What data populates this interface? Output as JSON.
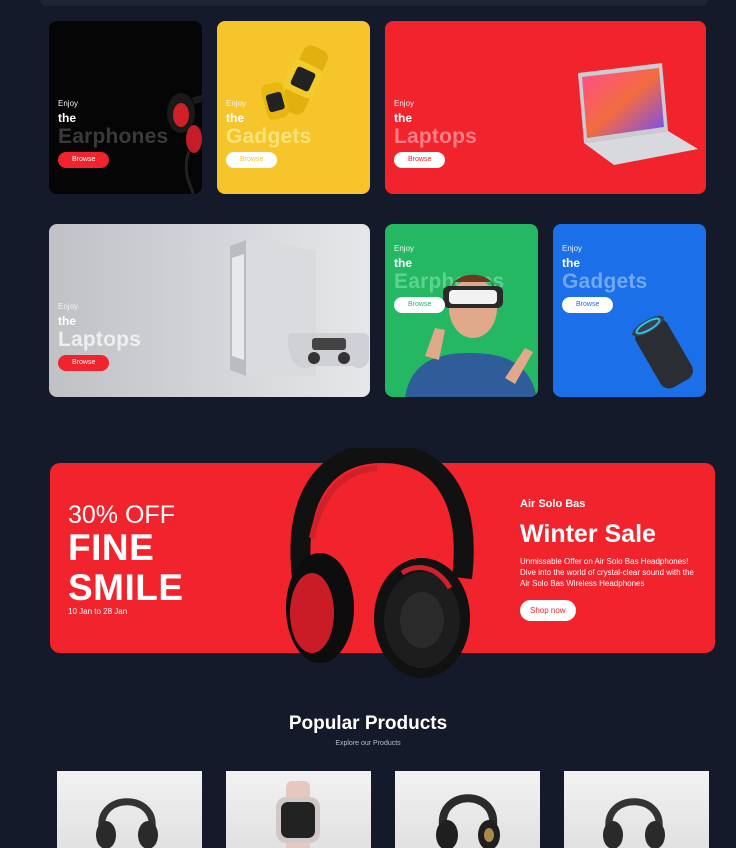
{
  "cards": [
    {
      "enjoy": "Enjoy",
      "the": "the",
      "title": "Earphones",
      "button": "Browse"
    },
    {
      "enjoy": "Enjoy",
      "the": "the",
      "title": "Gadgets",
      "button": "Browse"
    },
    {
      "enjoy": "Enjoy",
      "the": "the",
      "title": "Laptops",
      "button": "Browse"
    },
    {
      "enjoy": "Enjoy",
      "the": "the",
      "title": "Laptops",
      "button": "Browse"
    },
    {
      "enjoy": "Enjoy",
      "the": "the",
      "title": "Earphones",
      "button": "Browse"
    },
    {
      "enjoy": "Enjoy",
      "the": "the",
      "title": "Gadgets",
      "button": "Browse"
    }
  ],
  "hero": {
    "discount": "30% OFF",
    "line1": "FINE",
    "line2": "SMILE",
    "dates": "10 Jan to 28 Jan",
    "brand": "Air Solo Bas",
    "sale_title": "Winter Sale",
    "description": "Unmissable Offer on Air Solo Bas Headphones! Dive into the world of crystal-clear sound with the Air Solo Bas Wireless Headphones",
    "button": "Shop now"
  },
  "popular": {
    "title": "Popular Products",
    "subtitle": "Explore our Products"
  },
  "colors": {
    "background": "#141a29",
    "red": "#f1232d",
    "yellow": "#f5c52b",
    "green": "#24b863",
    "blue": "#1b6fe8"
  }
}
